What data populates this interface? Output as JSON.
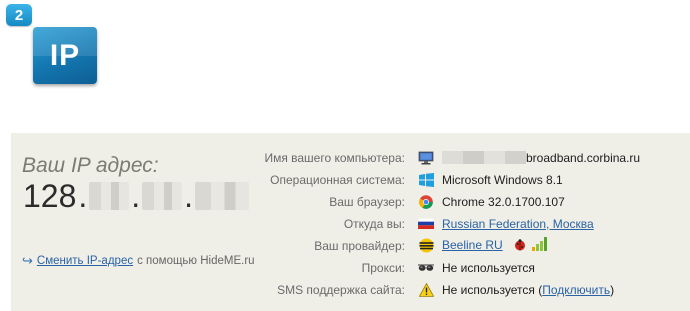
{
  "header": {
    "step_number": "2",
    "logo_text": "IP"
  },
  "ip_box": {
    "label": "Ваш IP адрес:",
    "ip_first_octet": "128",
    "ip_separator": ".",
    "change_link": "Сменить IP-адрес",
    "change_suffix": "с помощью HideME.ru"
  },
  "info": {
    "rows": [
      {
        "label": "Имя вашего компьютера:",
        "value": "broadband.corbina.ru",
        "icon": "computer-icon"
      },
      {
        "label": "Операционная система:",
        "value": "Microsoft Windows 8.1",
        "icon": "windows-icon"
      },
      {
        "label": "Ваш браузер:",
        "value": "Chrome 32.0.1700.107",
        "icon": "chrome-icon"
      },
      {
        "label": "Откуда вы:",
        "value": "Russian Federation, Москва",
        "icon": "russia-flag-icon"
      },
      {
        "label": "Ваш провайдер:",
        "value": "Beeline RU",
        "icon": "beeline-icon"
      },
      {
        "label": "Прокси:",
        "value": "Не используется",
        "icon": "sunglasses-icon"
      },
      {
        "label": "SMS поддержка сайта:",
        "value_prefix": "Не используется (",
        "link": "Подключить",
        "value_suffix": ")",
        "icon": "warning-icon"
      }
    ]
  },
  "colors": {
    "accent_blue": "#1689c4",
    "panel_bg": "#efeee7",
    "link": "#2a63a6"
  }
}
